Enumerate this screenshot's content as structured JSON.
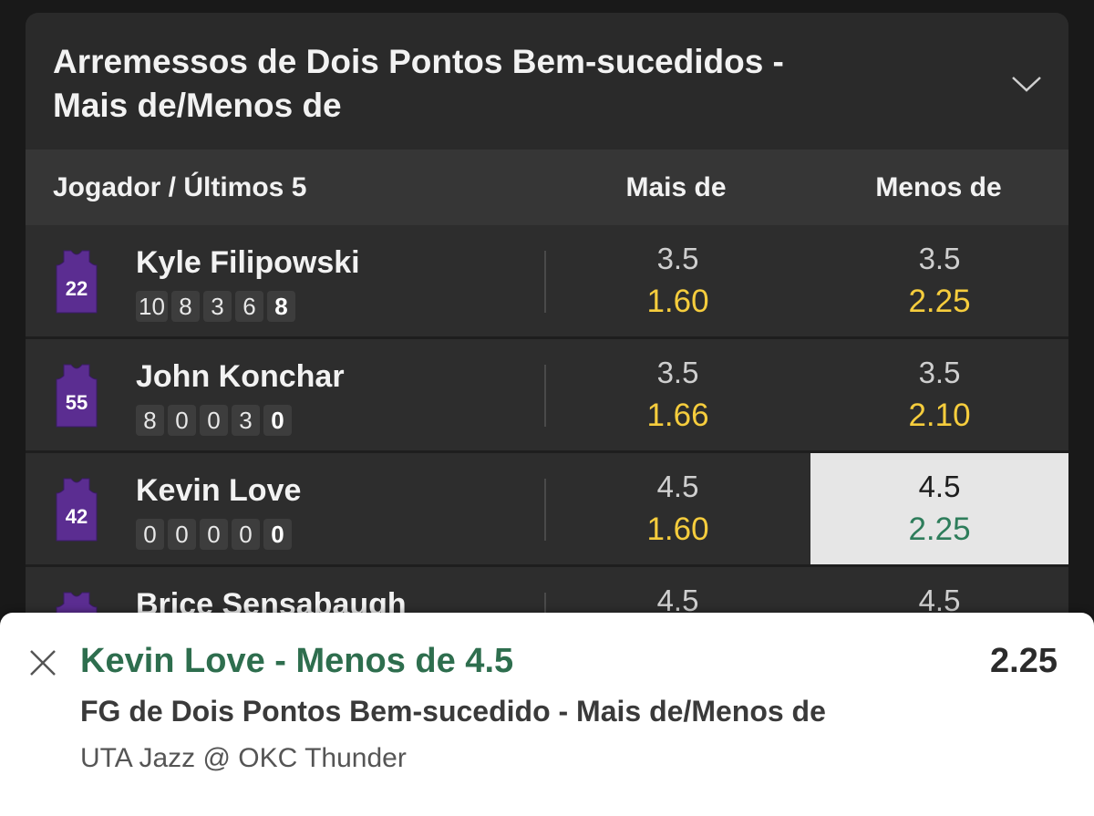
{
  "market": {
    "title_line1": "Arremessos de Dois Pontos Bem-sucedidos -",
    "title_line2": "Mais de/Menos de",
    "expand_icon": "chevron-down-icon"
  },
  "columns": {
    "player": "Jogador / Últimos 5",
    "over": "Mais de",
    "under": "Menos de"
  },
  "jersey_color": "#5b2d91",
  "players": [
    {
      "name": "Kyle Filipowski",
      "number": "22",
      "last5": [
        "10",
        "8",
        "3",
        "6",
        "8"
      ],
      "over": {
        "line": "3.5",
        "odds": "1.60"
      },
      "under": {
        "line": "3.5",
        "odds": "2.25"
      }
    },
    {
      "name": "John Konchar",
      "number": "55",
      "last5": [
        "8",
        "0",
        "0",
        "3",
        "0"
      ],
      "over": {
        "line": "3.5",
        "odds": "1.66"
      },
      "under": {
        "line": "3.5",
        "odds": "2.10"
      }
    },
    {
      "name": "Kevin Love",
      "number": "42",
      "last5": [
        "0",
        "0",
        "0",
        "0",
        "0"
      ],
      "over": {
        "line": "4.5",
        "odds": "1.60"
      },
      "under": {
        "line": "4.5",
        "odds": "2.25"
      }
    },
    {
      "name": "Brice Sensabaugh",
      "number": "",
      "last5": [],
      "over": {
        "line": "4.5",
        "odds": ""
      },
      "under": {
        "line": "4.5",
        "odds": ""
      }
    }
  ],
  "betslip": {
    "selection": "Kevin Love - Menos de 4.5",
    "odds": "2.25",
    "market": "FG de Dois Pontos Bem-sucedido - Mais de/Menos de",
    "event": "UTA Jazz @ OKC Thunder",
    "close_icon": "close-icon"
  },
  "colors": {
    "odds": "#f6cd3d",
    "selected_odds": "#2e7d5b",
    "selection_title": "#2e6e4e"
  }
}
